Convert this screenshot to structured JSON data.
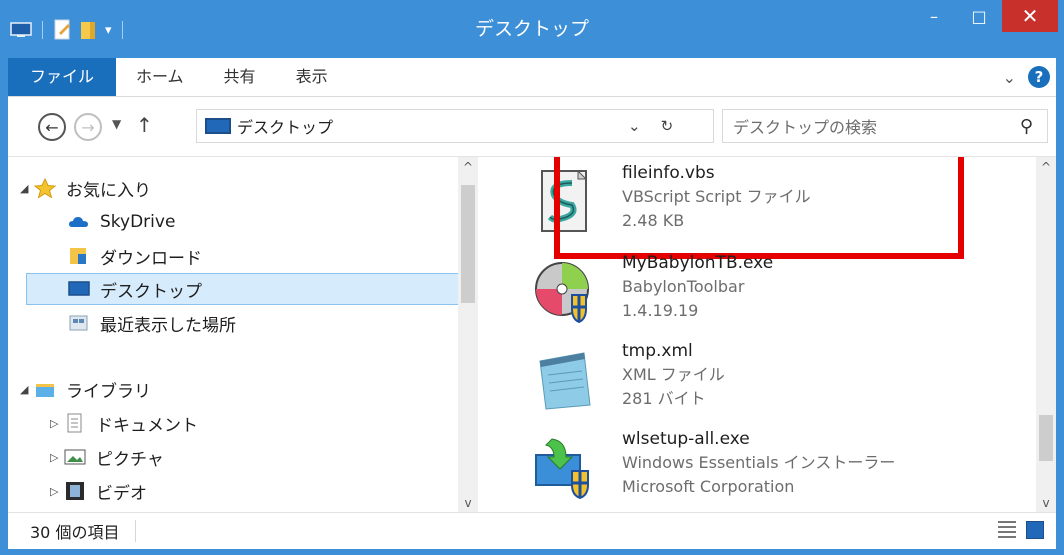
{
  "window": {
    "title": "デスクトップ"
  },
  "window_controls": {
    "minimize": "–",
    "maximize": "□",
    "close": "✕"
  },
  "ribbon": {
    "tabs": [
      {
        "label": "ファイル",
        "active": true
      },
      {
        "label": "ホーム"
      },
      {
        "label": "共有"
      },
      {
        "label": "表示"
      }
    ],
    "expand": "⌄",
    "help": "?"
  },
  "address_bar": {
    "path": "デスクトップ",
    "refresh": "↻",
    "search_placeholder": "デスクトップの検索"
  },
  "nav_pane": {
    "favorites": "お気に入り",
    "skydrive": "SkyDrive",
    "downloads": "ダウンロード",
    "desktop": "デスクトップ",
    "recent": "最近表示した場所",
    "libraries": "ライブラリ",
    "documents": "ドキュメント",
    "pictures": "ピクチャ",
    "videos": "ビデオ"
  },
  "files": [
    {
      "name": "fileinfo.vbs",
      "type": "VBScript Script ファイル",
      "detail": "2.48 KB",
      "icon": "vbscript-file-icon"
    },
    {
      "name": "MyBabylonTB.exe",
      "type": "BabylonToolbar",
      "detail": "1.4.19.19",
      "icon": "installer-disc-icon"
    },
    {
      "name": "tmp.xml",
      "type": "XML ファイル",
      "detail": "281 バイト",
      "icon": "xml-notepad-icon"
    },
    {
      "name": "wlsetup-all.exe",
      "type": "Windows Essentials インストーラー",
      "detail": "Microsoft Corporation",
      "icon": "windows-setup-icon"
    }
  ],
  "status_bar": {
    "item_count": "30 個の項目"
  },
  "colors": {
    "titlebar": "#3d8fd8",
    "file_tab": "#1a6fbd",
    "close": "#c7302b",
    "highlight": "#e50000",
    "selected": "#d6ebfb"
  }
}
